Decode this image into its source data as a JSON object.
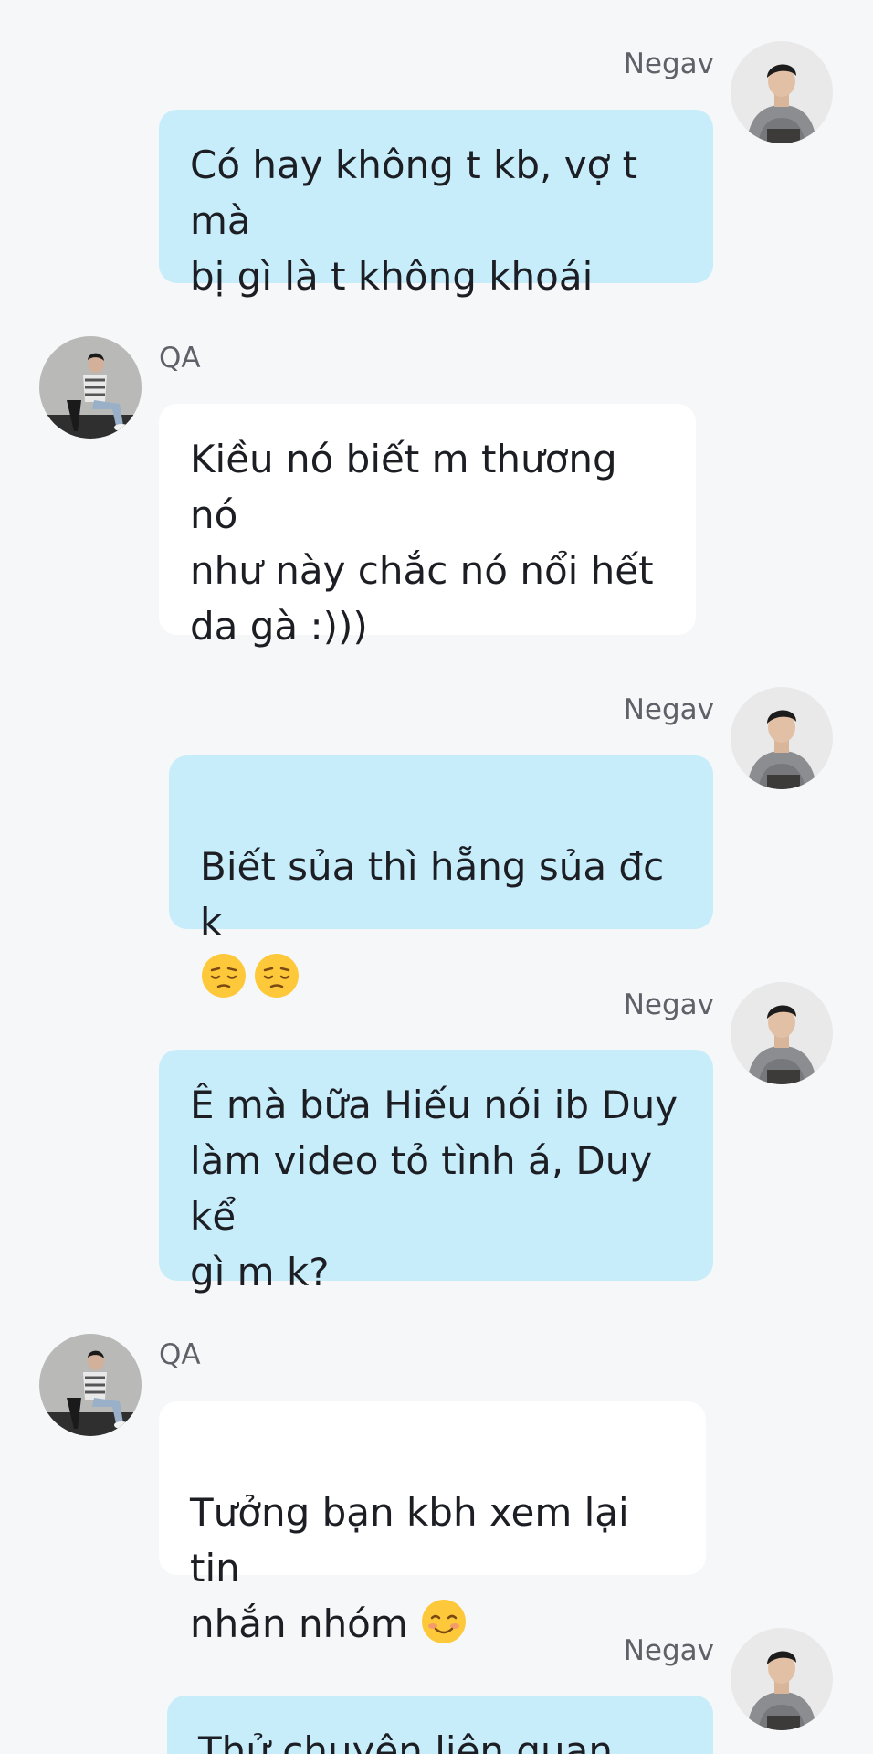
{
  "messages": [
    {
      "direction": "out",
      "sender": "Negav",
      "avatar": "negav-avatar",
      "text": "Có hay không t kb, vợ t mà\nbị gì là t không khoái"
    },
    {
      "direction": "in",
      "sender": "QA",
      "avatar": "qa-avatar",
      "text": "Kiều nó biết m thương nó\nnhư này chắc nó nổi hết\nda gà :)))"
    },
    {
      "direction": "out",
      "sender": "Negav",
      "avatar": "negav-avatar",
      "text": "Biết sủa thì hẵng sủa đc k",
      "emojis": [
        "pensive-face-emoji",
        "pensive-face-emoji"
      ]
    },
    {
      "direction": "out",
      "sender": "Negav",
      "avatar": "negav-avatar",
      "text": "Ê mà bữa Hiếu nói ib Duy\nlàm video tỏ tình á, Duy kể\ngì m k?"
    },
    {
      "direction": "in",
      "sender": "QA",
      "avatar": "qa-avatar",
      "text": "Tưởng bạn kbh xem lại tin\nnhắn nhóm ",
      "emojis": [
        "smiling-face-emoji"
      ]
    },
    {
      "direction": "out",
      "sender": "Negav",
      "avatar": "negav-avatar",
      "text": "Thử chuyện liên quan đến"
    }
  ],
  "colors": {
    "background": "#f6f7f9",
    "outgoing_bubble": "#c7edfb",
    "incoming_bubble": "#ffffff",
    "sender_name": "#5e6168",
    "message_text": "#1c1e23"
  }
}
